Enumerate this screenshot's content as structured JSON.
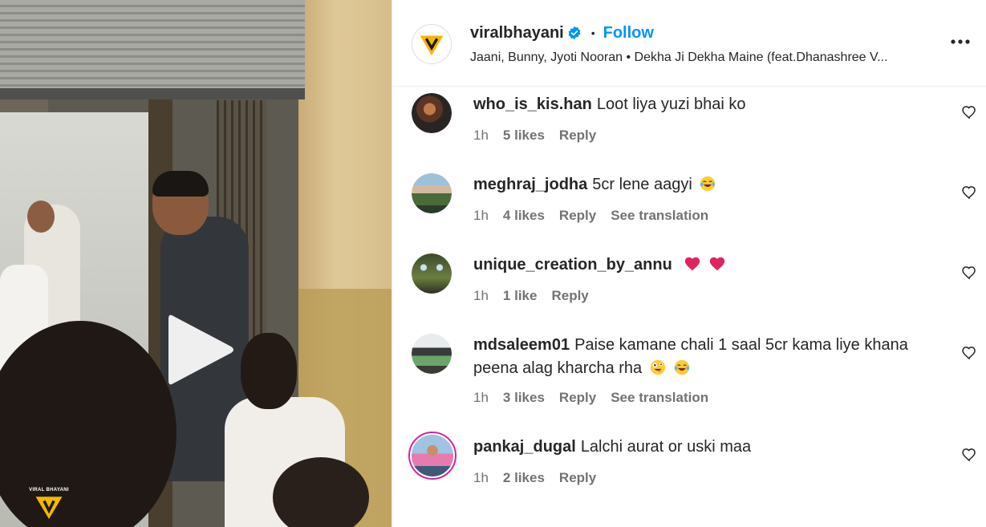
{
  "post": {
    "author": "viralbhayani",
    "follow_label": "Follow",
    "separator": "•",
    "audio": "Jaani, Bunny, Jyoti Nooran • Dekha Ji Dekha Maine (feat.Dhanashree V...",
    "watermark": "VIRAL BHAYANI"
  },
  "comments": [
    {
      "user": "who_is_kis.han",
      "text": "Loot liya yuzi bhai ko",
      "time": "1h",
      "likes": "5 likes",
      "reply": "Reply",
      "translate": "",
      "emojis": []
    },
    {
      "user": "meghraj_jodha",
      "text": "5cr lene aagyi",
      "time": "1h",
      "likes": "4 likes",
      "reply": "Reply",
      "translate": "See translation",
      "emojis": [
        "laughing-tears"
      ]
    },
    {
      "user": "unique_creation_by_annu",
      "text": "",
      "time": "1h",
      "likes": "1 like",
      "reply": "Reply",
      "translate": "",
      "emojis": [
        "red-heart",
        "red-heart"
      ]
    },
    {
      "user": "mdsaleem01",
      "text": "Paise kamane chali 1 saal 5cr kama liye khana peena alag kharcha rha",
      "time": "1h",
      "likes": "3 likes",
      "reply": "Reply",
      "translate": "See translation",
      "emojis": [
        "zany-face",
        "laughing-tears"
      ]
    },
    {
      "user": "pankaj_dugal",
      "text": "Lalchi aurat or uski maa",
      "time": "1h",
      "likes": "2 likes",
      "reply": "Reply",
      "translate": "",
      "emojis": []
    }
  ],
  "colors": {
    "accent": "#0095f6",
    "text": "#262626",
    "muted": "#737373",
    "verified": "#0095f6",
    "heart_emoji": "#e0245e",
    "brand_yellow": "#f5b800"
  }
}
